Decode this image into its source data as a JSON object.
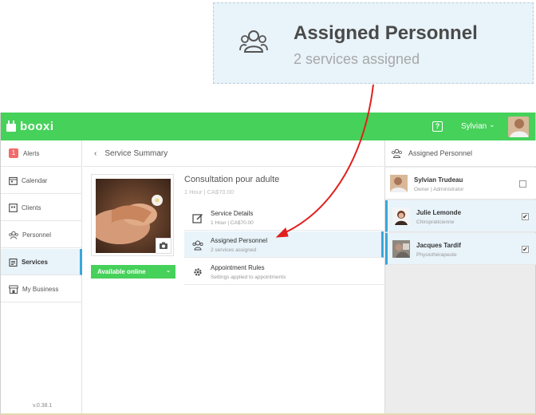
{
  "callout": {
    "title": "Assigned Personnel",
    "subtitle": "2 services assigned"
  },
  "topbar": {
    "logo": "booxi",
    "help_glyph": "?",
    "user_name": "Sylvian",
    "caret": "⌄"
  },
  "sidebar": {
    "alerts_count": "1",
    "items": [
      {
        "label": "Alerts"
      },
      {
        "label": "Calendar"
      },
      {
        "label": "Clients"
      },
      {
        "label": "Personnel"
      },
      {
        "label": "Services"
      },
      {
        "label": "My Business"
      }
    ],
    "version": "v.0.38.1"
  },
  "middle": {
    "back_glyph": "‹",
    "header": "Service Summary",
    "service_title": "Consultation pour adulte",
    "service_sub": "1 Hour | CA$70.00",
    "availability": "Available online",
    "availability_caret": "⌄",
    "rows": [
      {
        "title": "Service Details",
        "sub": "1 Hour | CA$70.00"
      },
      {
        "title": "Assigned Personnel",
        "sub": "2 services assigned"
      },
      {
        "title": "Appointment Rules",
        "sub": "Settings applied to appointments"
      }
    ]
  },
  "right": {
    "header": "Assigned Personnel",
    "people": [
      {
        "name": "Sylvian Trudeau",
        "role": "Owner | Administrator",
        "checked": false,
        "mark": ""
      },
      {
        "name": "Julie Lemonde",
        "role": "Chiropraticienne",
        "checked": true,
        "mark": "✔"
      },
      {
        "name": "Jacques Tardif",
        "role": "Physiothérapeute",
        "checked": true,
        "mark": "✔"
      }
    ]
  },
  "colors": {
    "brand_green": "#46d15a",
    "accent_blue": "#3aa6dc",
    "alert_red": "#f26b6b",
    "annotation_red": "#e0201e"
  }
}
